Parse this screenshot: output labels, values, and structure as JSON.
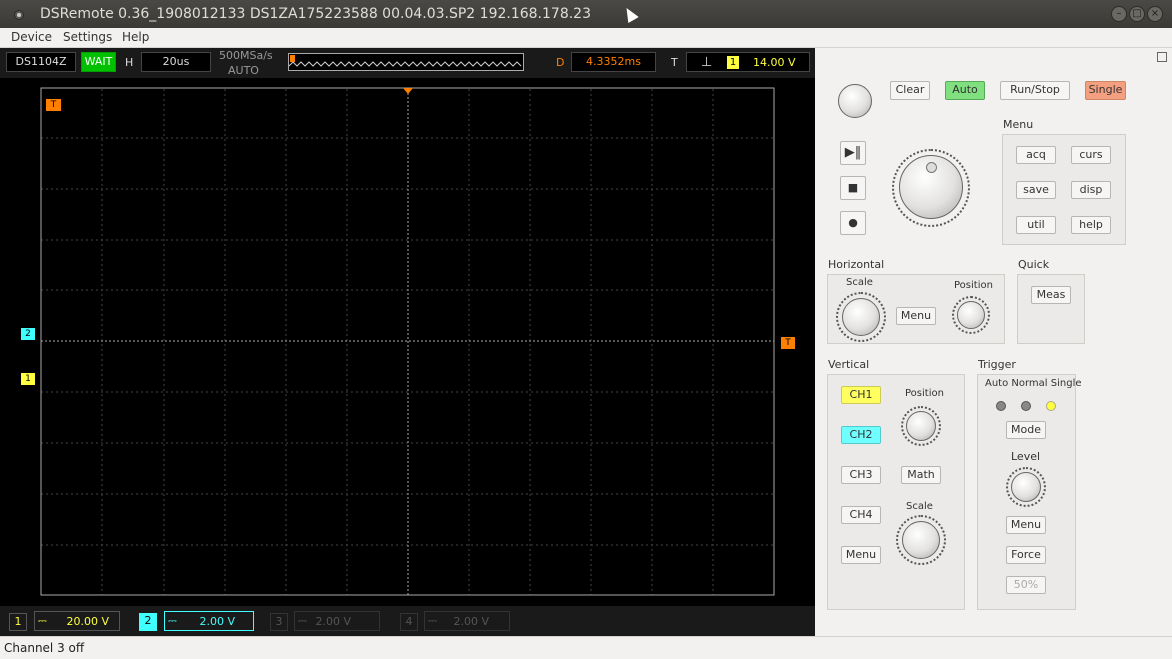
{
  "window": {
    "title": "DSRemote 0.36_1908012133   DS1ZA175223588   00.04.03.SP2   192.168.178.23"
  },
  "menu": [
    "Device",
    "Settings",
    "Help"
  ],
  "infobar": {
    "model": "DS1104Z",
    "state": "WAIT",
    "h_label": "H",
    "timebase": "20us",
    "sample_rate": "500MSa/s",
    "acq_mode": "AUTO",
    "d_label": "D",
    "delay": "4.3352ms",
    "t_label": "T",
    "trig_channel": "1",
    "trig_level": "14.00 V"
  },
  "markers": {
    "trigger_top": "T",
    "trigger_right": "T",
    "ch2": "2",
    "ch1": "1"
  },
  "channels": [
    {
      "num": "1",
      "value": "20.00 V",
      "color": "#ffff40",
      "active": true
    },
    {
      "num": "2",
      "value": "2.00 V",
      "color": "#40ffff",
      "active": true
    },
    {
      "num": "3",
      "value": "2.00 V",
      "color": "#555555",
      "active": false
    },
    {
      "num": "4",
      "value": "2.00 V",
      "color": "#555555",
      "active": false
    }
  ],
  "status": "Channel 3 off",
  "panel": {
    "top_buttons": {
      "clear": "Clear",
      "auto": "Auto",
      "runstop": "Run/Stop",
      "single": "Single"
    },
    "menu_title": "Menu",
    "menu_buttons": [
      "acq",
      "curs",
      "save",
      "disp",
      "util",
      "help"
    ],
    "horizontal": {
      "title": "Horizontal",
      "scale": "Scale",
      "menu": "Menu",
      "position": "Position"
    },
    "quick": {
      "title": "Quick",
      "meas": "Meas"
    },
    "vertical": {
      "title": "Vertical",
      "ch1": "CH1",
      "ch2": "CH2",
      "ch3": "CH3",
      "ch4": "CH4",
      "math": "Math",
      "menu": "Menu",
      "position": "Position",
      "scale": "Scale"
    },
    "trigger": {
      "title": "Trigger",
      "modes": "Auto Normal Single",
      "mode": "Mode",
      "level": "Level",
      "menu": "Menu",
      "force": "Force",
      "fifty": "50%"
    }
  },
  "colors": {
    "accent_orange": "#ff8000",
    "ch1": "#ffff40",
    "ch2": "#40ffff",
    "state_green": "#00c000"
  }
}
